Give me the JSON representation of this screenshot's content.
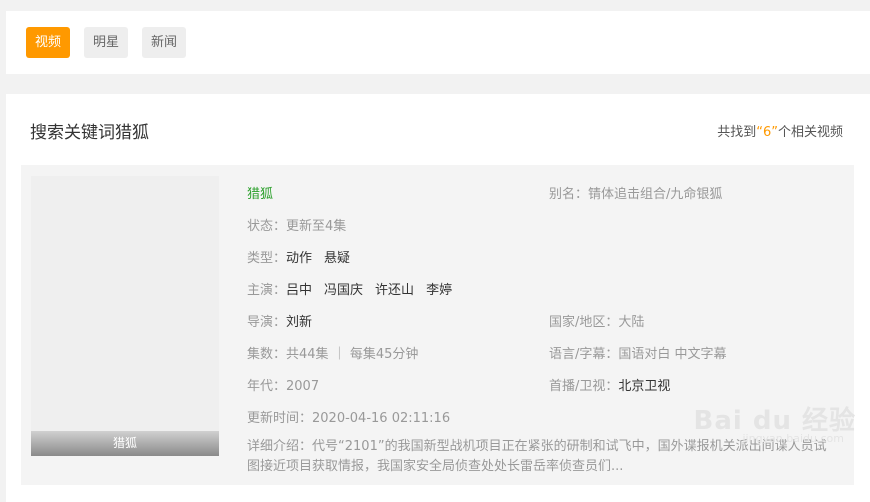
{
  "tabs": [
    {
      "label": "视频",
      "active": true
    },
    {
      "label": "明星",
      "active": false
    },
    {
      "label": "新闻",
      "active": false
    }
  ],
  "search": {
    "title": "搜索关键词猎狐",
    "count_prefix": "共找到",
    "count_value": "“6”",
    "count_suffix": "个相关视频"
  },
  "result": {
    "poster_caption": "猎狐",
    "title": "猎狐",
    "alias_label": "别名：",
    "alias": "锖体追击组合/九命银狐",
    "status_label": "状态：",
    "status": "更新至4集",
    "genre_label": "类型：",
    "genres": [
      "动作",
      "悬疑"
    ],
    "cast_label": "主演：",
    "cast": [
      "吕中",
      "冯国庆",
      "许还山",
      "李婷"
    ],
    "director_label": "导演：",
    "director": "刘新",
    "region_label": "国家/地区：",
    "region": "大陆",
    "episodes_label": "集数：",
    "episodes": "共44集 ｜ 每集45分钟",
    "language_label": "语言/字幕：",
    "language": "国语对白 中文字幕",
    "year_label": "年代：",
    "year": "2007",
    "premiere_label": "首播/卫视：",
    "premiere": "北京卫视",
    "updated_label": "更新时间：",
    "updated": "2020-04-16 02:11:16",
    "desc_label": "详细介绍：",
    "desc": "代号“2101”的我国新型战机项目正在紧张的研制和试飞中，国外谍报机关派出间谍人员试图接近项目获取情报，我国家安全局侦查处处长雷岳率侦查员们..."
  },
  "watermark": {
    "text": "Bai du 经验",
    "sub": "jingyan.baidu.com"
  },
  "colors": {
    "accent": "#ff9900",
    "title_green": "#2ca02c"
  }
}
